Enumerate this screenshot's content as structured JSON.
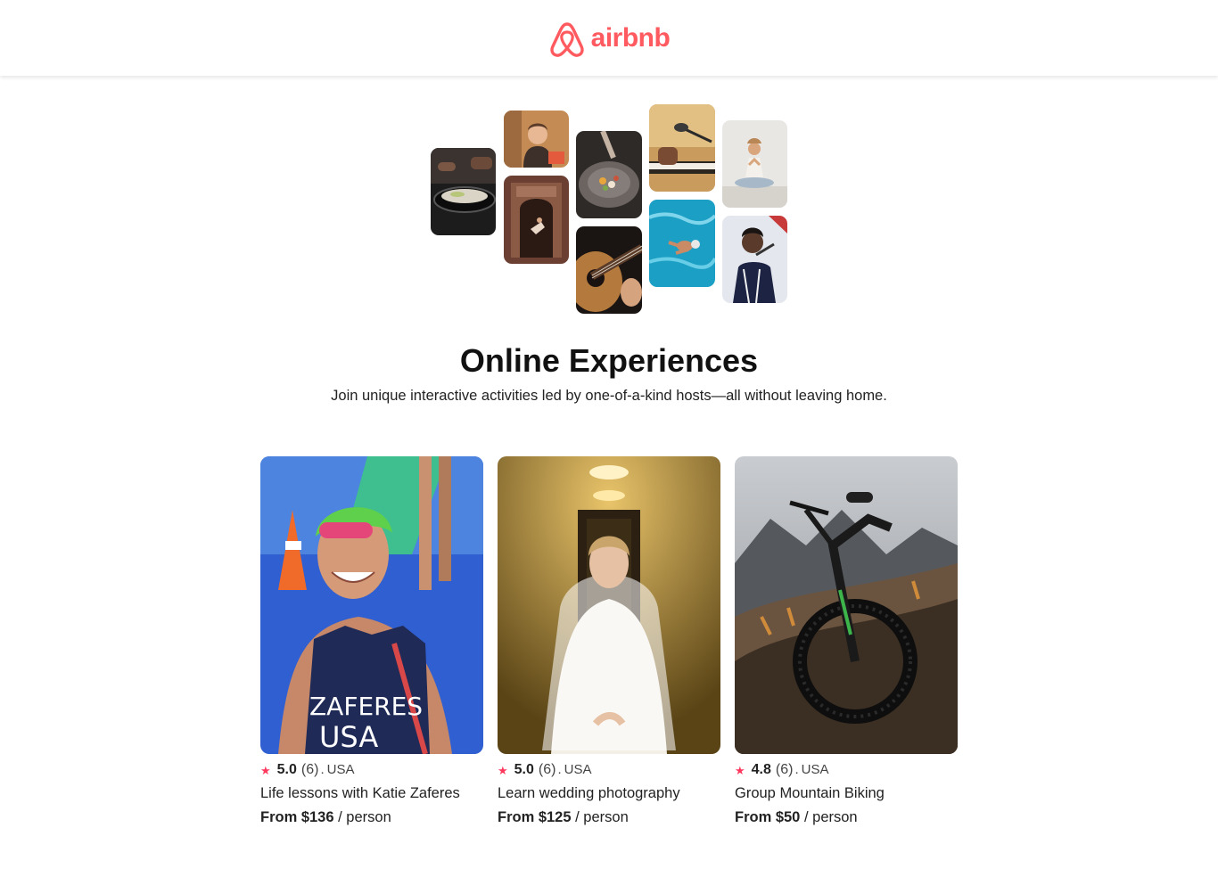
{
  "header": {
    "brand_name": "airbnb",
    "brand_color": "#FF5A5F"
  },
  "hero": {
    "photo_tiles": [
      "cooking-pan-photo",
      "woman-host-photo",
      "ornate-doorway-dancer-photo",
      "plated-dish-photo",
      "acoustic-guitar-photo",
      "microphone-keyboard-photo",
      "swimmer-pool-photo",
      "yoga-meditation-photo",
      "singer-performer-photo"
    ],
    "title": "Online Experiences",
    "subtitle": "Join unique interactive activities led by one-of-a-kind hosts—all without leaving home."
  },
  "cards": [
    {
      "image": "triathlete-photo",
      "star_icon": "star-icon",
      "rating": "5.0",
      "review_count": "(6)",
      "separator": ".",
      "country": "USA",
      "title": "Life lessons with Katie Zaferes",
      "price_prefix": "From $136",
      "price_suffix": "/ person"
    },
    {
      "image": "bride-hallway-photo",
      "star_icon": "star-icon",
      "rating": "5.0",
      "review_count": "(6)",
      "separator": ".",
      "country": "USA",
      "title": "Learn wedding photography",
      "price_prefix": "From $125",
      "price_suffix": "/ person"
    },
    {
      "image": "mountain-bike-photo",
      "star_icon": "star-icon",
      "rating": "4.8",
      "review_count": "(6)",
      "separator": ".",
      "country": "USA",
      "title": "Group Mountain Biking",
      "price_prefix": "From $50",
      "price_suffix": "/ person"
    }
  ],
  "colors": {
    "star": "#FE385C",
    "text": "#222222"
  }
}
